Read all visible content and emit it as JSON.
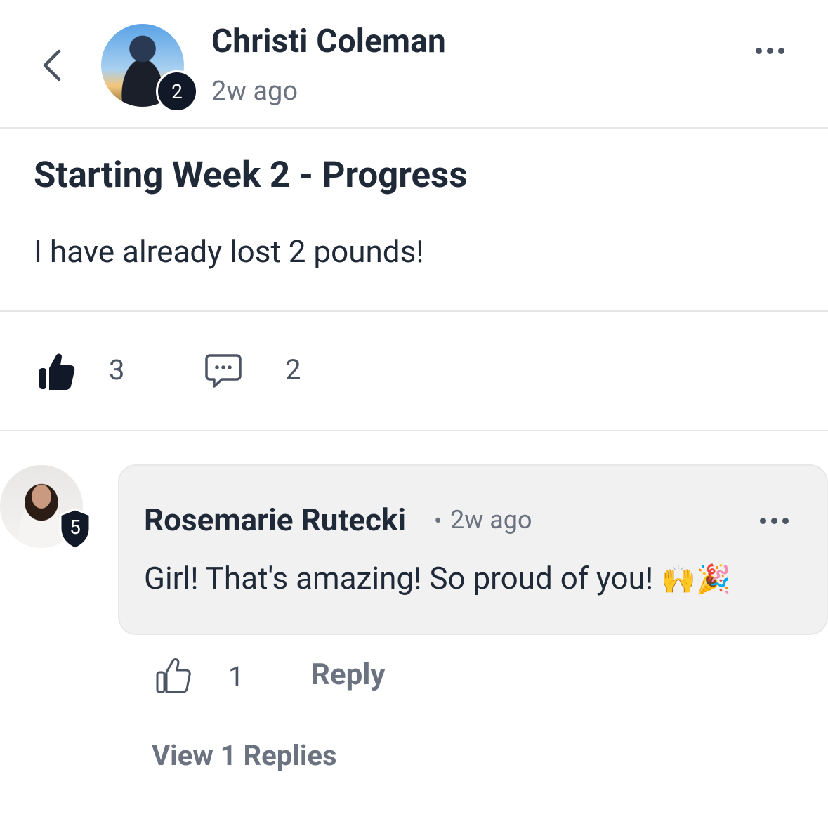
{
  "post": {
    "author_name": "Christi Coleman",
    "time_ago": "2w ago",
    "author_level": "2",
    "title": "Starting Week 2 - Progress",
    "body": "I have already lost 2 pounds!",
    "like_count": "3",
    "comment_count": "2",
    "liked": true
  },
  "comment": {
    "author_name": "Rosemarie Rutecki",
    "separator": "•",
    "time_ago": "2w ago",
    "author_level": "5",
    "text": "Girl! That's amazing! So proud of you!",
    "emojis": "🙌🎉",
    "like_count": "1",
    "reply_label": "Reply",
    "view_replies_label": "View 1 Replies"
  },
  "icons": {
    "back": "chevron-left-icon",
    "more": "more-horizontal-icon",
    "like": "thumbs-up-icon",
    "comment": "comment-icon"
  },
  "colors": {
    "text_primary": "#1f2937",
    "text_secondary": "#6b7280",
    "badge_dark": "#111827",
    "bubble_bg": "#f1f1f2",
    "divider": "#e6e6e6"
  }
}
